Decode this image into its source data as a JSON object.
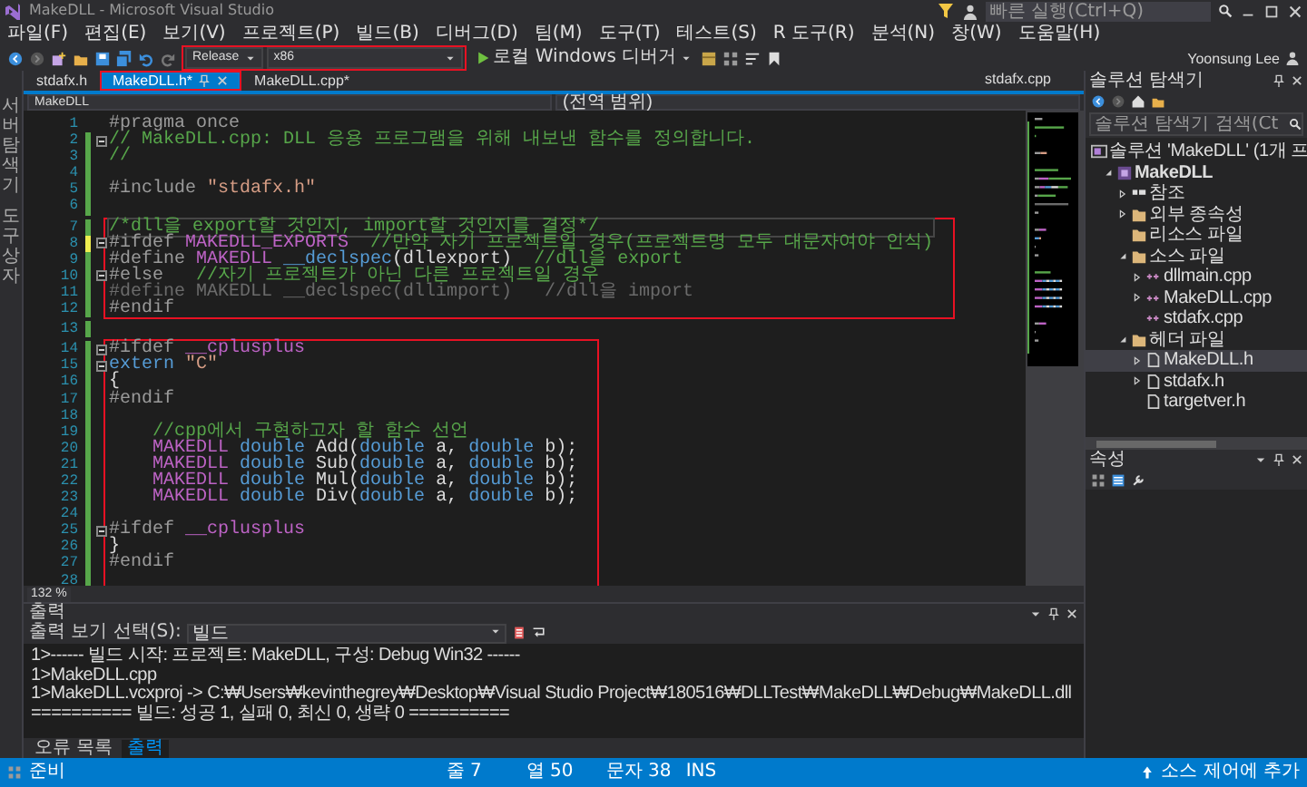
{
  "window": {
    "title": "MakeDLL - Microsoft Visual Studio",
    "quick_launch_placeholder": "빠른 실행(Ctrl+Q)"
  },
  "menu": [
    "파일(F)",
    "편집(E)",
    "보기(V)",
    "프로젝트(P)",
    "빌드(B)",
    "디버그(D)",
    "팀(M)",
    "도구(T)",
    "테스트(S)",
    "R 도구(R)",
    "분석(N)",
    "창(W)",
    "도움말(H)"
  ],
  "user": "Yoonsung Lee",
  "toolbar": {
    "configuration": "Release",
    "platform": "x86",
    "annotated": true,
    "debugger": "로컬 Windows 디버거"
  },
  "doc_tabs": [
    {
      "label": "stdafx.h",
      "selected": false,
      "annotated": false
    },
    {
      "label": "MakeDLL.h*",
      "selected": true,
      "annotated": true
    },
    {
      "label": "MakeDLL.cpp*",
      "selected": false,
      "annotated": false
    }
  ],
  "preview_tab": "stdafx.cpp",
  "nav": {
    "project": "MakeDLL",
    "scope": "(전역 범위)"
  },
  "side_tabs": [
    "서버 탐색기",
    "도구 상자"
  ],
  "code": {
    "groups": [
      {
        "boxed": false,
        "lines": [
          {
            "number": "1",
            "current": false,
            "fold": false,
            "changed": false,
            "segments": [
              {
                "kind": "pp",
                "text": "#pragma once"
              }
            ]
          },
          {
            "number": "2",
            "current": false,
            "fold": true,
            "changed": true,
            "saved": true,
            "segments": [
              {
                "kind": "comment",
                "text": "// MakeDLL.cpp: DLL 응용 프로그램을 위해 내보낸 함수를 정의합니다."
              }
            ]
          },
          {
            "number": "3",
            "current": false,
            "fold": false,
            "changed": true,
            "saved": true,
            "segments": [
              {
                "kind": "comment",
                "text": "//"
              }
            ]
          },
          {
            "number": "4",
            "current": false,
            "fold": false,
            "changed": true,
            "saved": true
          },
          {
            "number": "5",
            "current": false,
            "fold": false,
            "changed": true,
            "saved": true,
            "segments": [
              {
                "kind": "pp",
                "text": "#include "
              },
              {
                "kind": "string",
                "text": "\"stdafx.h\""
              }
            ]
          },
          {
            "number": "6",
            "current": false,
            "fold": false,
            "changed": true,
            "saved": true
          }
        ]
      },
      {
        "boxed": true,
        "lines": [
          {
            "number": "7",
            "current": true,
            "fold": false,
            "changed": true,
            "saved": true,
            "segments": [
              {
                "kind": "comment",
                "text": "/*dll을 export할 것인지, import할 것인지를 결정*/"
              }
            ]
          },
          {
            "number": "8",
            "current": false,
            "fold": true,
            "changed": true,
            "saved": false,
            "segments": [
              {
                "kind": "pp",
                "text": "#ifdef "
              },
              {
                "kind": "macro",
                "text": "MAKEDLL_EXPORTS"
              },
              {
                "kind": "comment",
                "text": "  //만약 자기 프로젝트일 경우(프로젝트명 모두 대문자여야 인식)"
              }
            ]
          },
          {
            "number": "9",
            "current": false,
            "fold": false,
            "changed": true,
            "saved": true,
            "segments": [
              {
                "kind": "pp",
                "text": "#define "
              },
              {
                "kind": "macro",
                "text": "MAKEDLL "
              },
              {
                "kind": "keyword",
                "text": "__declspec"
              },
              {
                "kind": "plain",
                "text": "(dllexport)"
              },
              {
                "kind": "comment",
                "text": "  //dll을 export"
              }
            ]
          },
          {
            "number": "10",
            "current": false,
            "fold": true,
            "changed": true,
            "saved": true,
            "segments": [
              {
                "kind": "pp",
                "text": "#else"
              },
              {
                "kind": "comment",
                "text": "   //자기 프로젝트가 아닌 다른 프로젝트일 경우"
              }
            ]
          },
          {
            "number": "11",
            "current": false,
            "fold": false,
            "changed": true,
            "saved": true,
            "segments": [
              {
                "kind": "inactive",
                "text": "#define MAKEDLL __declspec(dllimport)   //dll을 import"
              }
            ]
          },
          {
            "number": "12",
            "current": false,
            "fold": false,
            "changed": true,
            "saved": true,
            "segments": [
              {
                "kind": "pp",
                "text": "#endif"
              }
            ]
          }
        ]
      },
      {
        "boxed": false,
        "lines": [
          {
            "number": "13",
            "current": false,
            "fold": false,
            "changed": true,
            "saved": true
          }
        ]
      },
      {
        "boxed": true,
        "lines": [
          {
            "number": "14",
            "current": false,
            "fold": true,
            "changed": true,
            "saved": true,
            "segments": [
              {
                "kind": "pp",
                "text": "#ifdef "
              },
              {
                "kind": "macro",
                "text": "__cplusplus"
              }
            ]
          },
          {
            "number": "15",
            "current": false,
            "fold": true,
            "changed": true,
            "saved": true,
            "segments": [
              {
                "kind": "keyword",
                "text": "extern "
              },
              {
                "kind": "string",
                "text": "\"C\""
              }
            ]
          },
          {
            "number": "16",
            "current": false,
            "fold": false,
            "changed": true,
            "saved": true,
            "segments": [
              {
                "kind": "plain",
                "text": "{"
              }
            ]
          },
          {
            "number": "17",
            "current": false,
            "fold": false,
            "changed": true,
            "saved": true,
            "segments": [
              {
                "kind": "pp",
                "text": "#endif"
              }
            ]
          },
          {
            "number": "18",
            "current": false,
            "fold": false,
            "changed": true,
            "saved": true
          },
          {
            "number": "19",
            "current": false,
            "fold": false,
            "changed": true,
            "saved": true,
            "segments": [
              {
                "kind": "comment",
                "text": "    //cpp에서 구현하고자 할 함수 선언"
              }
            ]
          },
          {
            "number": "20",
            "current": false,
            "fold": false,
            "changed": true,
            "saved": true,
            "segments": [
              {
                "kind": "macro",
                "text": "    MAKEDLL "
              },
              {
                "kind": "keyword",
                "text": "double"
              },
              {
                "kind": "plain",
                "text": " Add("
              },
              {
                "kind": "keyword",
                "text": "double"
              },
              {
                "kind": "plain",
                "text": " a, "
              },
              {
                "kind": "keyword",
                "text": "double"
              },
              {
                "kind": "plain",
                "text": " b);"
              }
            ]
          },
          {
            "number": "21",
            "current": false,
            "fold": false,
            "changed": true,
            "saved": true,
            "segments": [
              {
                "kind": "macro",
                "text": "    MAKEDLL "
              },
              {
                "kind": "keyword",
                "text": "double"
              },
              {
                "kind": "plain",
                "text": " Sub("
              },
              {
                "kind": "keyword",
                "text": "double"
              },
              {
                "kind": "plain",
                "text": " a, "
              },
              {
                "kind": "keyword",
                "text": "double"
              },
              {
                "kind": "plain",
                "text": " b);"
              }
            ]
          },
          {
            "number": "22",
            "current": false,
            "fold": false,
            "changed": true,
            "saved": true,
            "segments": [
              {
                "kind": "macro",
                "text": "    MAKEDLL "
              },
              {
                "kind": "keyword",
                "text": "double"
              },
              {
                "kind": "plain",
                "text": " Mul("
              },
              {
                "kind": "keyword",
                "text": "double"
              },
              {
                "kind": "plain",
                "text": " a, "
              },
              {
                "kind": "keyword",
                "text": "double"
              },
              {
                "kind": "plain",
                "text": " b);"
              }
            ]
          },
          {
            "number": "23",
            "current": false,
            "fold": false,
            "changed": true,
            "saved": true,
            "segments": [
              {
                "kind": "macro",
                "text": "    MAKEDLL "
              },
              {
                "kind": "keyword",
                "text": "double"
              },
              {
                "kind": "plain",
                "text": " Div("
              },
              {
                "kind": "keyword",
                "text": "double"
              },
              {
                "kind": "plain",
                "text": " a, "
              },
              {
                "kind": "keyword",
                "text": "double"
              },
              {
                "kind": "plain",
                "text": " b);"
              }
            ]
          },
          {
            "number": "24",
            "current": false,
            "fold": false,
            "changed": true,
            "saved": true
          },
          {
            "number": "25",
            "current": false,
            "fold": true,
            "changed": true,
            "saved": true,
            "segments": [
              {
                "kind": "pp",
                "text": "#ifdef "
              },
              {
                "kind": "macro",
                "text": "__cplusplus"
              }
            ]
          },
          {
            "number": "26",
            "current": false,
            "fold": false,
            "changed": true,
            "saved": true,
            "segments": [
              {
                "kind": "plain",
                "text": "}"
              }
            ]
          },
          {
            "number": "27",
            "current": false,
            "fold": false,
            "changed": true,
            "saved": true,
            "segments": [
              {
                "kind": "pp",
                "text": "#endif"
              }
            ]
          },
          {
            "number": "28",
            "current": false,
            "fold": false,
            "changed": true,
            "saved": true
          }
        ]
      }
    ]
  },
  "zoom": "132 %",
  "output": {
    "title": "출력",
    "source_label": "출력 보기 선택(S):",
    "source": "빌드",
    "lines": [
      "1>------ 빌드 시작: 프로젝트: MakeDLL, 구성: Debug Win32 ------",
      "1>MakeDLL.cpp",
      "1>MakeDLL.vcxproj -> C:₩Users₩kevinthegrey₩Desktop₩Visual Studio Project₩180516₩DLLTest₩MakeDLL₩Debug₩MakeDLL.dll",
      "========== 빌드: 성공 1, 실패 0, 최신 0, 생략 0 =========="
    ]
  },
  "bottom_tabs": [
    {
      "label": "오류 목록",
      "selected": false
    },
    {
      "label": "출력",
      "selected": true
    }
  ],
  "status": {
    "message": "준비",
    "line": "줄 7",
    "column": "열 50",
    "char": "문자 38",
    "mode": "INS",
    "source_control": "소스 제어에 추가"
  },
  "solution_explorer": {
    "title": "솔루션 탐색기",
    "search_placeholder": "솔루션 탐색기 검색(Ct",
    "tree": [
      {
        "label": "솔루션 'MakeDLL' (1개 프",
        "kind": "solution",
        "expandable": false,
        "selected": false,
        "children": [
          {
            "label": "MakeDLL",
            "kind": "project",
            "expandable": true,
            "expanded": true,
            "selected": false,
            "children": [
              {
                "label": "참조",
                "kind": "references",
                "expandable": true,
                "expanded": false,
                "selected": false
              },
              {
                "label": "외부 종속성",
                "kind": "folder",
                "expandable": true,
                "expanded": false,
                "selected": false
              },
              {
                "label": "리소스 파일",
                "kind": "folder",
                "expandable": false,
                "selected": false
              },
              {
                "label": "소스 파일",
                "kind": "folder",
                "expandable": true,
                "expanded": true,
                "selected": false,
                "children": [
                  {
                    "label": "dllmain.cpp",
                    "kind": "cpp",
                    "expandable": true,
                    "expanded": false,
                    "selected": false
                  },
                  {
                    "label": "MakeDLL.cpp",
                    "kind": "cpp",
                    "expandable": true,
                    "expanded": false,
                    "selected": false
                  },
                  {
                    "label": "stdafx.cpp",
                    "kind": "cpp",
                    "expandable": false,
                    "selected": false
                  }
                ]
              },
              {
                "label": "헤더 파일",
                "kind": "folder",
                "expandable": true,
                "expanded": true,
                "selected": false,
                "children": [
                  {
                    "label": "MakeDLL.h",
                    "kind": "header",
                    "expandable": true,
                    "expanded": false,
                    "selected": true
                  },
                  {
                    "label": "stdafx.h",
                    "kind": "header",
                    "expandable": true,
                    "expanded": false,
                    "selected": false
                  },
                  {
                    "label": "targetver.h",
                    "kind": "header",
                    "expandable": false,
                    "selected": false
                  }
                ]
              }
            ]
          }
        ]
      }
    ]
  },
  "properties": {
    "title": "속성"
  }
}
